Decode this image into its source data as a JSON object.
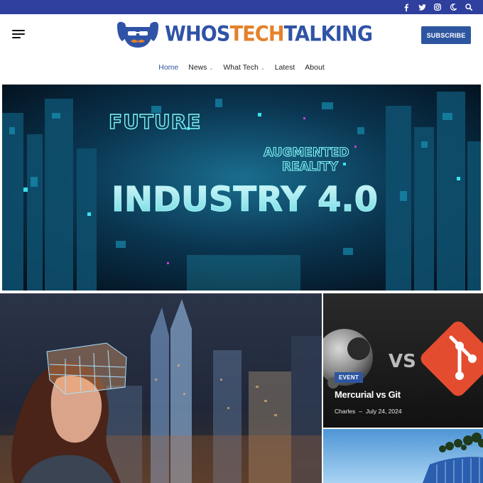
{
  "topbar": {
    "icons": [
      "facebook-icon",
      "twitter-icon",
      "instagram-icon",
      "moon-icon",
      "search-icon"
    ],
    "bg_color": "#2f3f9e"
  },
  "header": {
    "logo": {
      "part1": "WHOS",
      "part2": "TECH",
      "part3": "TALKING",
      "colors": {
        "primary": "#2f53a6",
        "accent": "#e5812b"
      }
    },
    "subscribe_label": "SUBSCRIBE"
  },
  "nav": {
    "items": [
      {
        "label": "Home",
        "active": true,
        "has_dropdown": false
      },
      {
        "label": "News",
        "active": false,
        "has_dropdown": true
      },
      {
        "label": "What Tech",
        "active": false,
        "has_dropdown": true
      },
      {
        "label": "Latest",
        "active": false,
        "has_dropdown": false
      },
      {
        "label": "About",
        "active": false,
        "has_dropdown": false
      }
    ]
  },
  "hero": {
    "image_text": {
      "line1": "FUTURE",
      "line2": "AUGMENTED",
      "line3": "REALITY",
      "line4": "INDUSTRY 4.0"
    }
  },
  "cards": {
    "side1": {
      "category": "EVENT",
      "title": "Mercurial vs Git",
      "author": "Charles",
      "separator": "–",
      "date": "July 24, 2024",
      "image_text": "VS"
    }
  }
}
